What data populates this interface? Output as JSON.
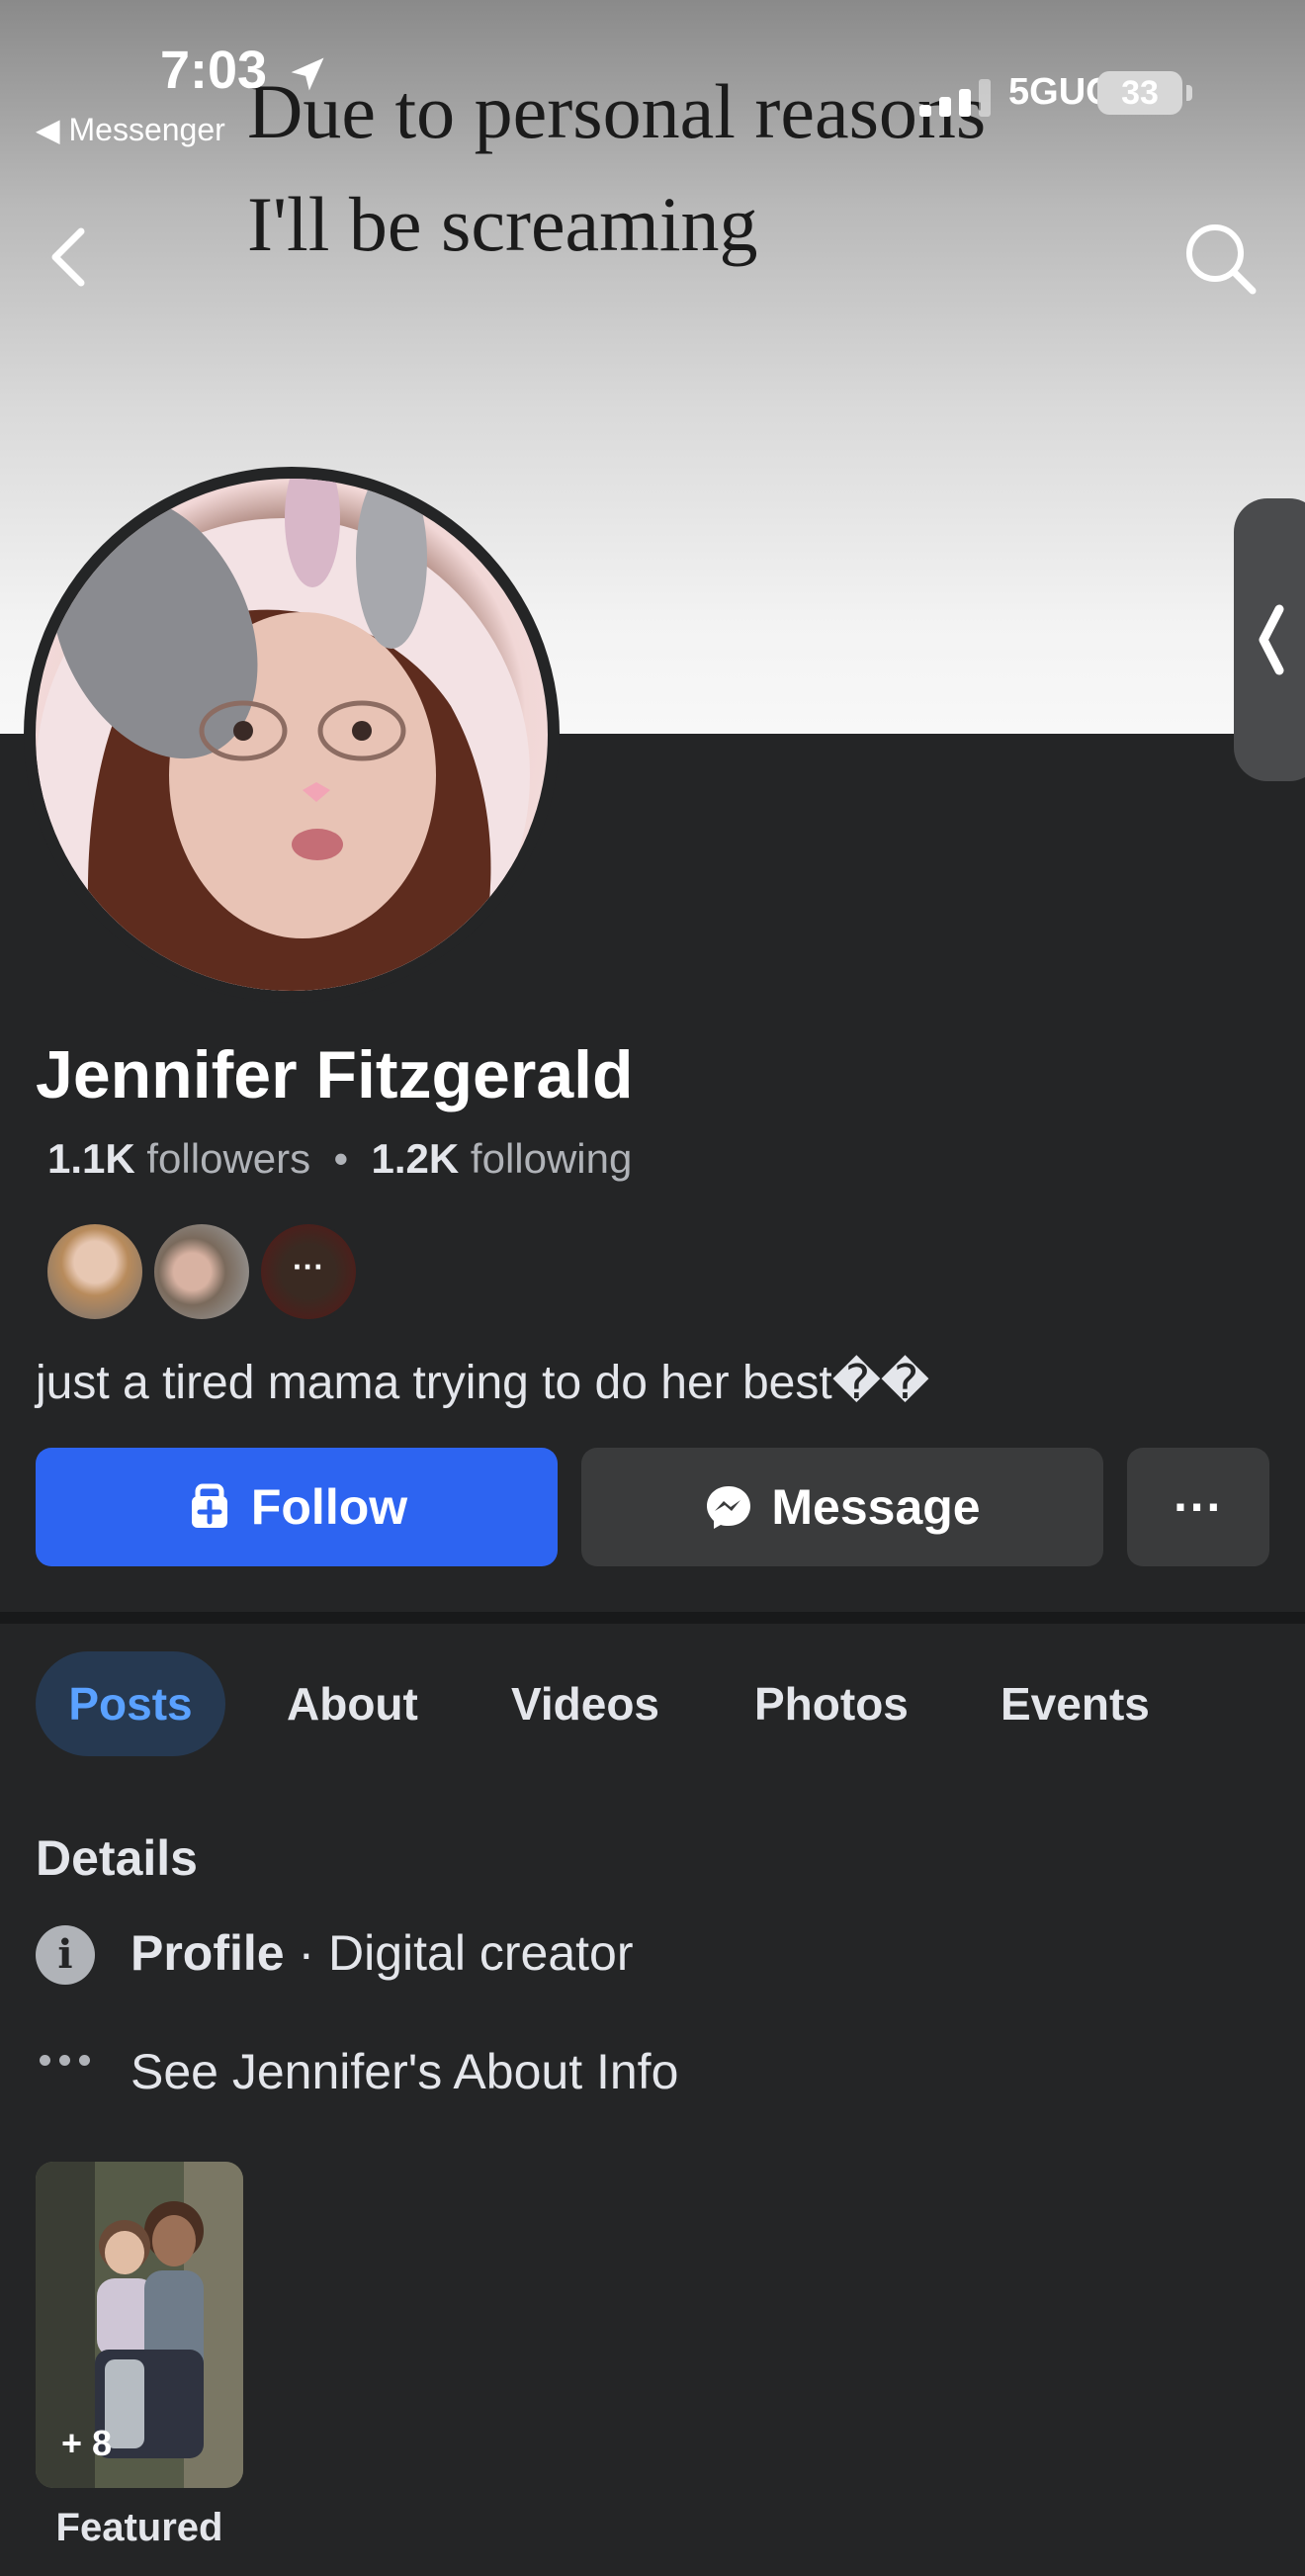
{
  "status_bar": {
    "time": "7:03",
    "back_app": "◀ Messenger",
    "network": "5GUC",
    "battery": "33"
  },
  "cover": {
    "line1": "Due to personal reasons",
    "line2": "I'll be screaming"
  },
  "profile": {
    "name": "Jennifer Fitzgerald",
    "followers_count": "1.1K",
    "followers_label": "followers",
    "separator": "•",
    "following_count": "1.2K",
    "following_label": "following",
    "bio": "just a tired mama trying to do her best��",
    "more_friends": "···"
  },
  "actions": {
    "follow": "Follow",
    "message": "Message",
    "more": "···"
  },
  "tabs": [
    "Posts",
    "About",
    "Videos",
    "Photos",
    "Events"
  ],
  "details": {
    "heading": "Details",
    "profile_bold": "Profile",
    "profile_rest": " · Digital creator",
    "about_link": "See Jennifer's About Info"
  },
  "featured": {
    "count": "+ 8",
    "label": "Featured"
  },
  "colors": {
    "accent": "#2d64f1",
    "background": "#242526",
    "tab_active_bg": "#263951",
    "tab_active_text": "#5aa1ff"
  },
  "icons": [
    "location-arrow-icon",
    "signal-icon",
    "battery-icon",
    "back-chevron-icon",
    "search-icon",
    "drawer-chevron-icon",
    "follow-add-icon",
    "messenger-icon",
    "more-dots-icon",
    "info-icon",
    "dots-icon"
  ]
}
